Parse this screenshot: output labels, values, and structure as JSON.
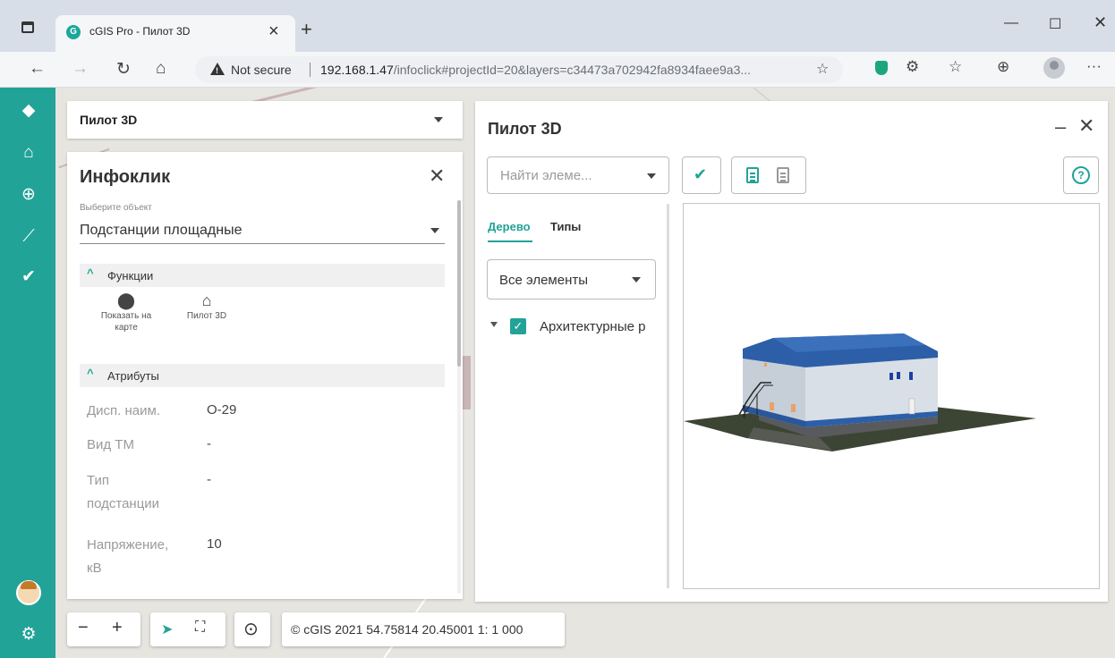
{
  "browser": {
    "tab_title": "cGIS Pro - Пилот 3D",
    "tab_favicon": "G",
    "not_secure": "Not secure",
    "url_host": "192.168.1.47",
    "url_path": "/infoclick#projectId=20&layers=c34473a702942fa8934faee9a3..."
  },
  "colors": {
    "accent": "#22a398",
    "chrome_bg": "#d8dee7",
    "building_roof": "#2c5fa8",
    "building_wall": "#d9dfe6",
    "ground": "#3c4434"
  },
  "layer_select": {
    "value": "Пилот 3D"
  },
  "infoclick": {
    "title": "Инфоклик",
    "select_hint": "Выберите объект",
    "selected_object": "Подстанции площадные",
    "functions_header": "Функции",
    "functions": [
      {
        "icon": "map-pin-icon",
        "label_line1": "Показать на",
        "label_line2": "карте"
      },
      {
        "icon": "building-3d-icon",
        "label_line1": "Пилот 3D",
        "label_line2": ""
      }
    ],
    "attributes_header": "Атрибуты",
    "attributes": [
      {
        "key_line1": "Дисп. наим.",
        "key_line2": "",
        "value": "О-29"
      },
      {
        "key_line1": "Вид ТМ",
        "key_line2": "",
        "value": "-"
      },
      {
        "key_line1": "Тип",
        "key_line2": "подстанции",
        "value": "-"
      },
      {
        "key_line1": "Напряжение,",
        "key_line2": "кВ",
        "value": "10"
      }
    ]
  },
  "pilot": {
    "title": "Пилот 3D",
    "search_placeholder": "Найти элеме...",
    "tabs": [
      "Дерево",
      "Типы"
    ],
    "filter_value": "Все элементы",
    "tree_items": [
      {
        "label": "Архитектурные р",
        "checked": true
      }
    ]
  },
  "map_controls": {
    "status": "© cGIS 2021  54.75814 20.45001  1: 1 000"
  }
}
